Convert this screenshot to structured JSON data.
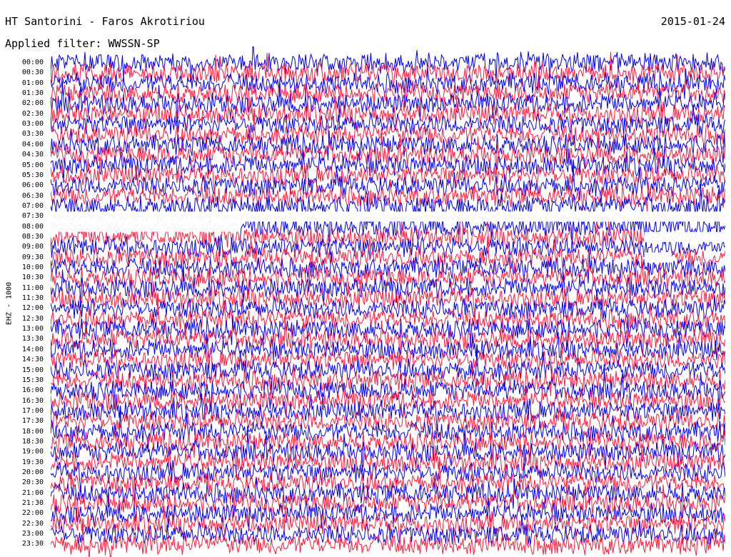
{
  "header": {
    "station": "HT Santorini - Faros Akrotiriou",
    "date": "2015-01-24",
    "filter": "Applied filter: WWSSN-SP"
  },
  "channel_label": "EHZ - 1000",
  "colors": {
    "trace_a": "#0000ee",
    "trace_b": "#ff1a3c",
    "background": "#ffffff",
    "gap": "#ffffff"
  },
  "chart_data": {
    "type": "helicorder",
    "title": "HT Santorini - Faros Akrotiriou",
    "date": "2015-01-24",
    "filter": "WWSSN-SP",
    "channel": "EHZ - 1000",
    "row_minutes": 30,
    "rows": [
      "00:00",
      "00:30",
      "01:00",
      "01:30",
      "02:00",
      "02:30",
      "03:00",
      "03:30",
      "04:00",
      "04:30",
      "05:00",
      "05:30",
      "06:00",
      "06:30",
      "07:00",
      "07:30",
      "08:00",
      "08:30",
      "09:00",
      "09:30",
      "10:00",
      "10:30",
      "11:00",
      "11:30",
      "12:00",
      "12:30",
      "13:00",
      "13:30",
      "14:00",
      "14:30",
      "15:00",
      "15:30",
      "16:00",
      "16:30",
      "17:00",
      "17:30",
      "18:00",
      "18:30",
      "19:00",
      "19:30",
      "20:00",
      "20:30",
      "21:00",
      "21:30",
      "22:00",
      "22:30",
      "23:00",
      "23:30"
    ],
    "trace_colors": [
      "#0000ee",
      "#ff1a3c"
    ],
    "gaps": [
      {
        "row": "07:30",
        "start_fraction": 0.0,
        "end_fraction": 1.0
      },
      {
        "row": "08:00",
        "start_fraction": 0.0,
        "end_fraction": 0.28
      },
      {
        "row": "08:30",
        "start_fraction": 0.88,
        "end_fraction": 1.0
      },
      {
        "row": "09:30",
        "start_fraction": 0.88,
        "end_fraction": 0.92
      }
    ]
  }
}
